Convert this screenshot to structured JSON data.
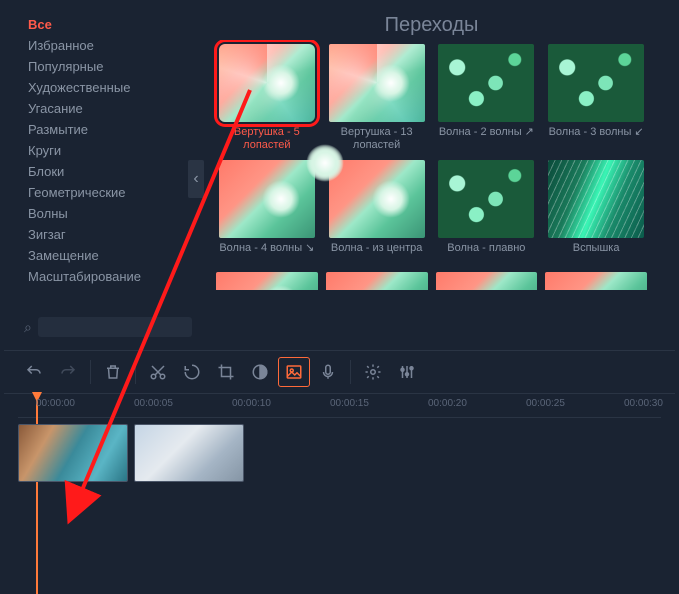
{
  "title": "Переходы",
  "categories": [
    {
      "label": "Все",
      "active": true
    },
    {
      "label": "Избранное",
      "active": false
    },
    {
      "label": "Популярные",
      "active": false
    },
    {
      "label": "Художественные",
      "active": false
    },
    {
      "label": "Угасание",
      "active": false
    },
    {
      "label": "Размытие",
      "active": false
    },
    {
      "label": "Круги",
      "active": false
    },
    {
      "label": "Блоки",
      "active": false
    },
    {
      "label": "Геометрические",
      "active": false
    },
    {
      "label": "Волны",
      "active": false
    },
    {
      "label": "Зигзаг",
      "active": false
    },
    {
      "label": "Замещение",
      "active": false
    },
    {
      "label": "Масштабирование",
      "active": false
    }
  ],
  "search": {
    "placeholder": ""
  },
  "transitions": [
    {
      "label": "Вертушка - 5 лопастей",
      "selected": true,
      "style": "flower-a swirl"
    },
    {
      "label": "Вертушка - 13 лопастей",
      "selected": false,
      "style": "flower-a swirl"
    },
    {
      "label": "Волна - 2 волны ↗",
      "selected": false,
      "style": "bokeh"
    },
    {
      "label": "Волна - 3 волны ↙",
      "selected": false,
      "style": "bokeh"
    },
    {
      "label": "Волна - 4 волны ↘",
      "selected": false,
      "style": "flower-a"
    },
    {
      "label": "Волна - из центра",
      "selected": false,
      "style": "flower-a"
    },
    {
      "label": "Волна - плавно",
      "selected": false,
      "style": "bokeh"
    },
    {
      "label": "Вспышка",
      "selected": false,
      "style": "fibers"
    }
  ],
  "ruler": [
    "00:00:00",
    "00:00:05",
    "00:00:10",
    "00:00:15",
    "00:00:20",
    "00:00:25",
    "00:00:30"
  ],
  "icons": {
    "collapse": "‹",
    "search": "⌕",
    "favorite": "♡"
  }
}
